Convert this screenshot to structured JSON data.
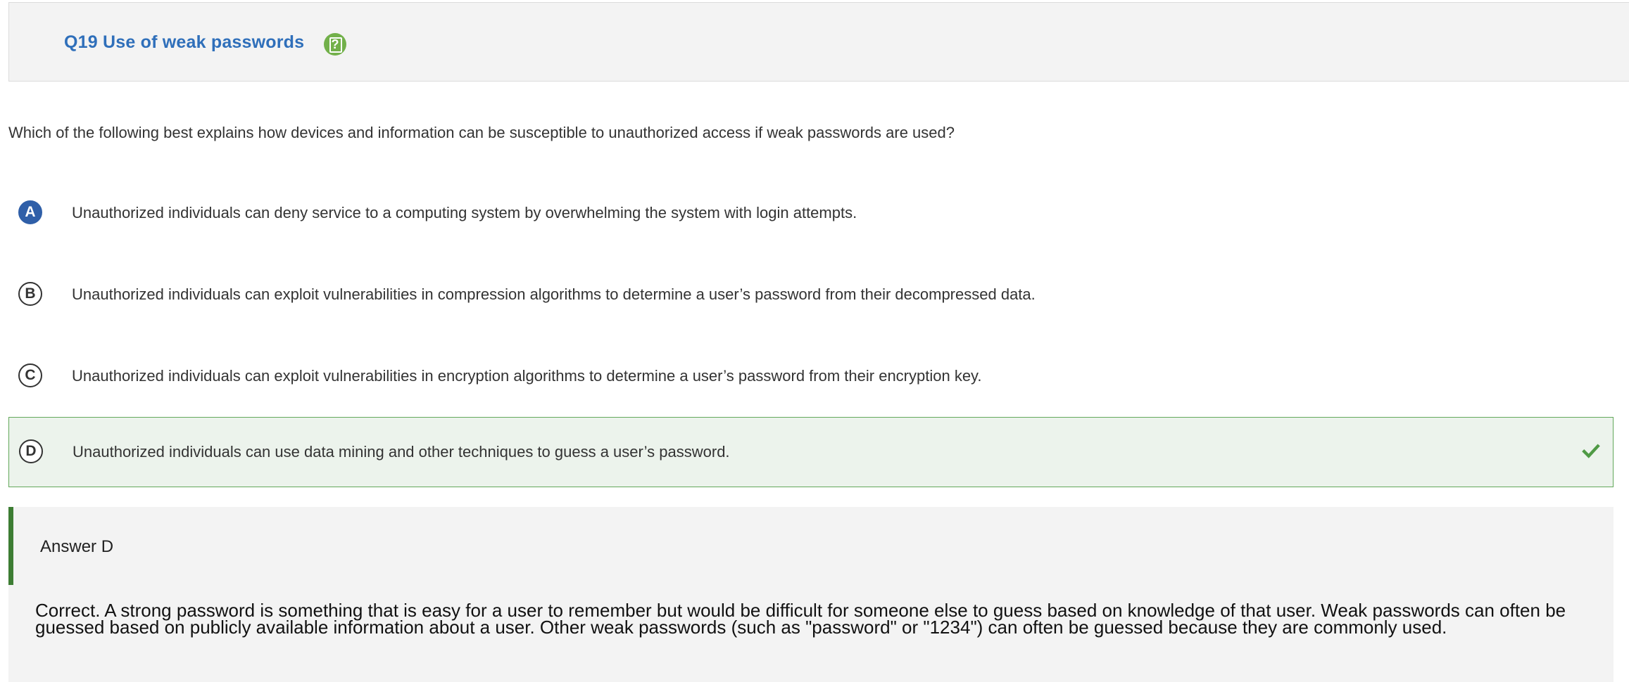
{
  "header": {
    "title": "Q19 Use of weak passwords",
    "help_icon": "help-icon",
    "help_glyph": "?"
  },
  "question": {
    "text": "Which of the following best explains how devices and information can be susceptible to unauthorized access if weak passwords are used?"
  },
  "options": [
    {
      "letter": "A",
      "text": "Unauthorized individuals can deny service to a computing system by overwhelming the system with login attempts.",
      "selected": true,
      "correct": false
    },
    {
      "letter": "B",
      "text": "Unauthorized individuals can exploit vulnerabilities in compression algorithms to determine a user’s password from their decompressed data.",
      "selected": false,
      "correct": false
    },
    {
      "letter": "C",
      "text": "Unauthorized individuals can exploit vulnerabilities in encryption algorithms to determine a user’s password from their encryption key.",
      "selected": false,
      "correct": false
    },
    {
      "letter": "D",
      "text": "Unauthorized individuals can use data mining and other techniques to guess a user’s password.",
      "selected": false,
      "correct": true
    }
  ],
  "answer": {
    "title": "Answer D",
    "explanation": "Correct. A strong password is something that is easy for a user to remember but would be difficult for someone else to guess based on knowledge of that user. Weak passwords can often be guessed based on publicly available information about a user. Other weak passwords (such as \"password\" or \"1234\") can often be guessed because they are commonly used."
  },
  "colors": {
    "title_blue": "#2f6fba",
    "help_green": "#72b04a",
    "selected_blue": "#2f5fa8",
    "correct_border": "#62a85a",
    "correct_bg": "#ecf3ec",
    "answer_bar": "#3d7d33",
    "check_green": "#4f9a45"
  }
}
